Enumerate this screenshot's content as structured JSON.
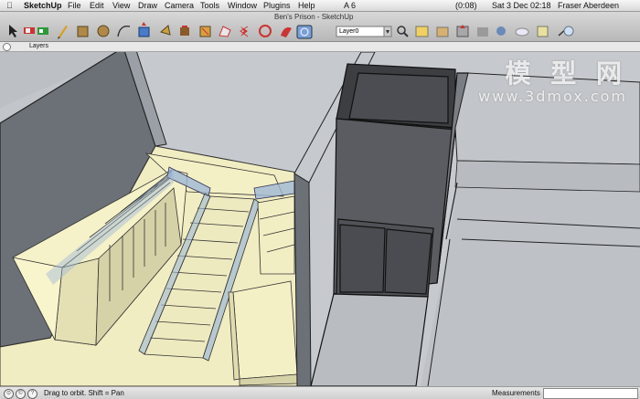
{
  "menubar": {
    "apple_icon": "apple-icon",
    "app_name": "SketchUp",
    "items": [
      "File",
      "Edit",
      "View",
      "Draw",
      "Camera",
      "Tools",
      "Window",
      "Plugins",
      "Help"
    ],
    "status_right": {
      "adobe": "A 6",
      "battery": "(0:08)",
      "clock": "Sat 3 Dec  02:18",
      "user": "Fraser Aberdeen"
    }
  },
  "window": {
    "title": "Ben's Prison - SketchUp"
  },
  "toolbar": {
    "layer_select": "Layer0",
    "tools": [
      "select-icon",
      "eraser-icon",
      "paint-icon",
      "pencil-icon",
      "rectangle-icon",
      "circle-icon",
      "arc-icon",
      "push-pull-icon",
      "move-icon",
      "rotate-icon",
      "offset-icon",
      "follow-me-icon",
      "scale-icon",
      "tape-icon",
      "protractor-icon",
      "orbit-icon"
    ]
  },
  "layers_palette": {
    "title": "Layers"
  },
  "watermark": {
    "chinese": "模 型 网",
    "url": "www.3dmox.com"
  },
  "statusbar": {
    "hint": "Drag to orbit.  Shift = Pan",
    "measurements_label": "Measurements",
    "measurements_value": ""
  },
  "colors": {
    "floor": "#b9bdc2",
    "wall_top": "#c9cdd1",
    "wall_side": "#6f737a",
    "cream": "#f3efc4",
    "cream_shade": "#d8d4aa",
    "dark_box": "#55575c",
    "glass": "#9fb8d6"
  }
}
